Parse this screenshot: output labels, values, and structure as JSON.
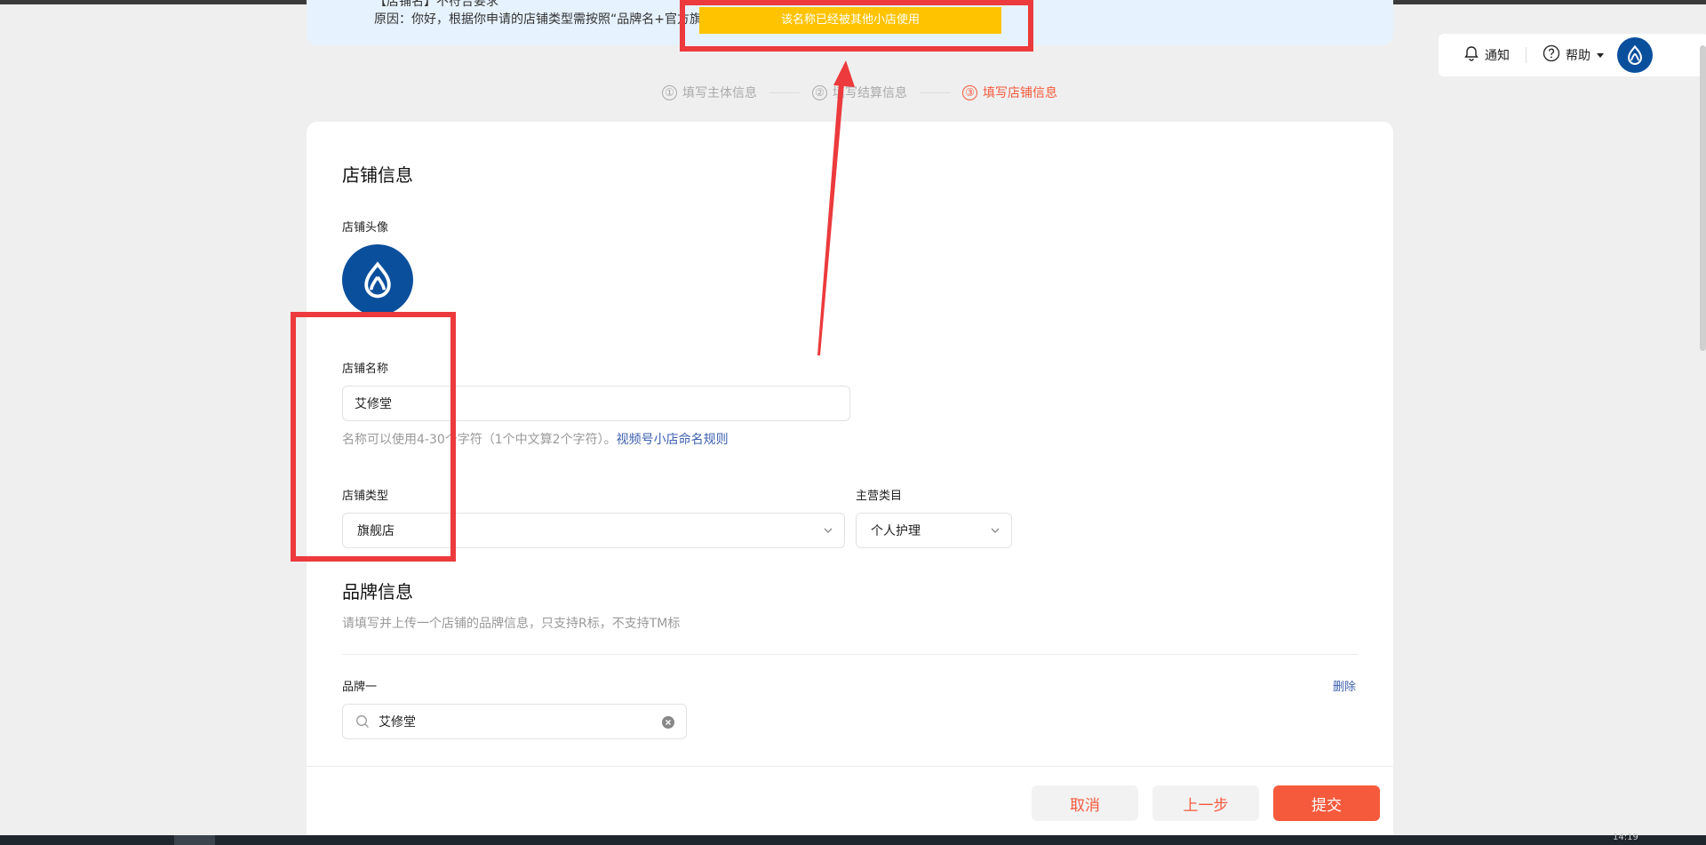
{
  "notice": {
    "cut_line": "【店铺名】不符合要求",
    "reason": "原因：你好，根据你申请的店铺类型需按照“品牌名+官方旗"
  },
  "toast": {
    "text": "该名称已经被其他小店使用"
  },
  "topbar": {
    "notify": "通知",
    "help": "帮助",
    "icons": [
      "bell-icon",
      "question-circle-icon",
      "caret-down-icon",
      "avatar"
    ]
  },
  "steps": [
    {
      "num": "①",
      "label": "填写主体信息"
    },
    {
      "num": "②",
      "label": "填写结算信息"
    },
    {
      "num": "③",
      "label": "填写店铺信息"
    }
  ],
  "shop": {
    "title": "店铺信息",
    "avatar_label": "店铺头像",
    "name_label": "店铺名称",
    "name_value": "艾修堂",
    "name_help": "名称可以使用4-30个字符（1个中文算2个字符）。",
    "name_rule_link": "视频号小店命名规则",
    "type_label": "店铺类型",
    "type_value": "旗舰店",
    "category_label": "主营类目",
    "category_value": "个人护理"
  },
  "brand": {
    "title": "品牌信息",
    "desc": "请填写并上传一个店铺的品牌信息，只支持R标，不支持TM标",
    "item_label": "品牌一",
    "delete": "删除",
    "search_value": "艾修堂"
  },
  "footer": {
    "cancel": "取消",
    "prev": "上一步",
    "submit": "提交"
  },
  "taskbar": {
    "clock": "14:19"
  },
  "colors": {
    "accent": "#f55a3c",
    "annotation_red": "#ec3a3d",
    "toast_yellow": "#ffc300",
    "avatar_blue": "#0a4f9c",
    "link_blue": "#3c5fb0"
  }
}
